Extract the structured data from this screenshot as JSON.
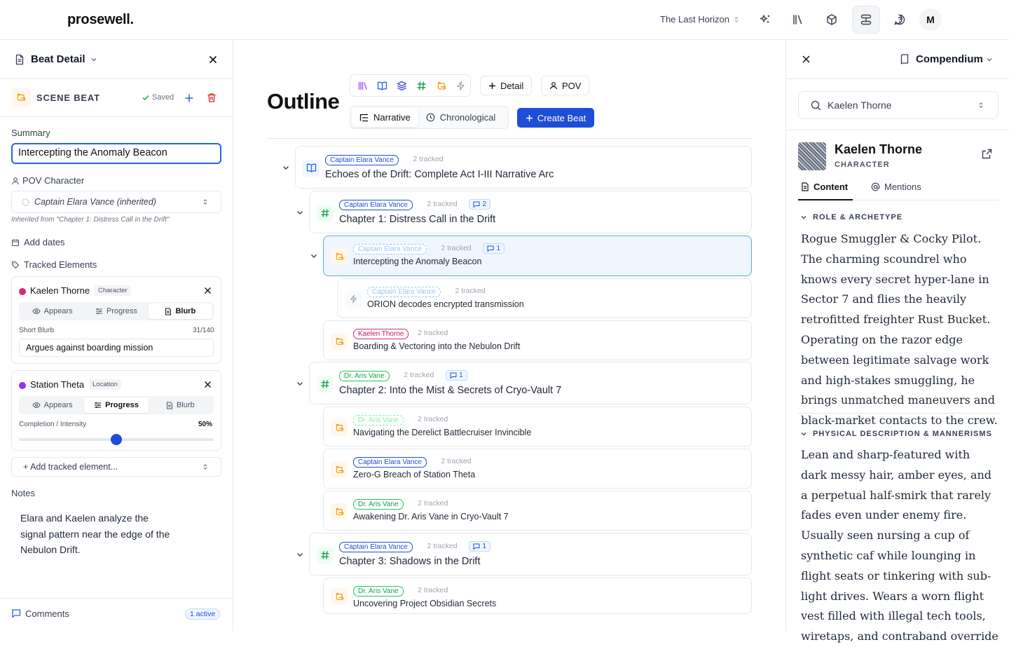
{
  "app": {
    "logo": "prosewell.",
    "project": "The Last Horizon",
    "avatar": "M"
  },
  "topbar": {
    "icons": [
      "sparkles-icon",
      "library-icon",
      "box-icon",
      "flow-icon",
      "help-icon"
    ]
  },
  "beat_panel": {
    "title": "Beat Detail",
    "beat_type": "SCENE BEAT",
    "saved": "Saved",
    "summary_label": "Summary",
    "summary": "Intercepting the Anomaly Beacon",
    "pov_label": "POV Character",
    "pov_value": "Captain Elara Vance (inherited)",
    "inherited_note": "Inherited from \"Chapter 1: Distress Call in the Drift\"",
    "add_dates": "Add dates",
    "tracked_label": "Tracked Elements",
    "tracked": [
      {
        "name": "Kaelen Thorne",
        "type": "Character",
        "color": "#db2777",
        "tabs": [
          "Appears",
          "Progress",
          "Blurb"
        ],
        "active_tab": "Blurb",
        "field_label": "Short Blurb",
        "count": "31/140",
        "value": "Argues against boarding mission"
      },
      {
        "name": "Station Theta",
        "type": "Location",
        "color": "#9333ea",
        "tabs": [
          "Appears",
          "Progress",
          "Blurb"
        ],
        "active_tab": "Progress",
        "field_label": "Completion / Intensity",
        "percent_text": "50%",
        "progress": 0.5
      }
    ],
    "add_tracked": "+ Add tracked element...",
    "notes_label": "Notes",
    "notes": "Elara and Kaelen analyze the signal pattern near the edge of the Nebulon Drift.",
    "comments_label": "Comments",
    "comments_badge": "1 active"
  },
  "outline": {
    "title": "Outline",
    "detail_btn": "Detail",
    "pov_btn": "POV",
    "view_narrative": "Narrative",
    "view_chrono": "Chronological",
    "create_btn": "Create Beat",
    "items": [
      {
        "pill": "Captain Elara Vance",
        "tracked": "2 tracked",
        "title": "Echoes of the Drift: Complete Act I-III Narrative Arc"
      },
      {
        "pill": "Captain Elara Vance",
        "tracked": "2 tracked",
        "comments": "2",
        "title": "Chapter 1: Distress Call in the Drift"
      },
      {
        "pill": "Captain Elara Vance",
        "tracked": "2 tracked",
        "comments": "1",
        "title": "Intercepting the Anomaly Beacon"
      },
      {
        "pill": "Captain Elara Vance",
        "tracked": "2 tracked",
        "title": "ORION decodes encrypted transmission"
      },
      {
        "pill": "Kaelen Thorne",
        "tracked": "2 tracked",
        "title": "Boarding & Vectoring into the Nebulon Drift"
      },
      {
        "pill": "Dr. Aris Vane",
        "tracked": "2 tracked",
        "comments": "1",
        "title": "Chapter 2: Into the Mist & Secrets of Cryo-Vault 7"
      },
      {
        "pill": "Dr. Aris Vane",
        "tracked": "2 tracked",
        "title": "Navigating the Derelict Battlecruiser Invincible"
      },
      {
        "pill": "Captain Elara Vance",
        "tracked": "2 tracked",
        "title": "Zero-G Breach of Station Theta"
      },
      {
        "pill": "Dr. Aris Vane",
        "tracked": "2 tracked",
        "title": "Awakening Dr. Aris Vane in Cryo-Vault 7"
      },
      {
        "pill": "Captain Elara Vance",
        "tracked": "2 tracked",
        "comments": "1",
        "title": "Chapter 3: Shadows in the Drift"
      },
      {
        "pill": "Dr. Aris Vane",
        "tracked": "2 tracked",
        "title": "Uncovering Project Obsidian Secrets"
      }
    ]
  },
  "compendium": {
    "title": "Compendium",
    "search_value": "Kaelen Thorne",
    "name": "Kaelen Thorne",
    "type": "CHARACTER",
    "tab_content": "Content",
    "tab_mentions": "Mentions",
    "sections": [
      {
        "heading": "ROLE & ARCHETYPE",
        "text": "Rogue Smuggler & Cocky Pilot. The charming scoundrel who knows every secret hyper-lane in Sector 7 and flies the heavily retrofitted freighter Rust Bucket. Operating on the razor edge between legitimate salvage work and high-stakes smuggling, he brings unmatched maneuvers and black-market contacts to the crew."
      },
      {
        "heading": "PHYSICAL DESCRIPTION & MANNERISMS",
        "text": "Lean and sharp-featured with dark messy hair, amber eyes, and a perpetual half-smirk that rarely fades even under enemy fire. Usually seen nursing a cup of synthetic caf while lounging in flight seats or tinkering with sub-light drives. Wears a worn flight vest filled with illegal tech tools, wiretaps, and contraband override"
      }
    ]
  },
  "colors": {
    "accent": "#2563eb",
    "pill_blue": "#1d4ed8",
    "pill_pink": "#be185d",
    "pill_green": "#16a34a"
  }
}
